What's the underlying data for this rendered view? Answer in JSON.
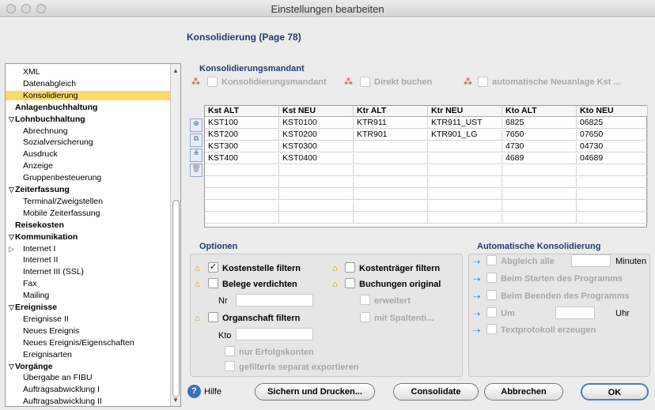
{
  "window": {
    "title": "Einstellungen bearbeiten"
  },
  "page_header": "Konsolidierung (Page 78)",
  "sidebar": {
    "items": [
      {
        "label": "XML",
        "bold": false,
        "tri": ""
      },
      {
        "label": "Datenabgleich",
        "bold": false,
        "tri": ""
      },
      {
        "label": "Konsolidierung",
        "bold": false,
        "tri": "",
        "selected": true
      },
      {
        "label": "Anlagenbuchhaltung",
        "bold": true,
        "tri": ""
      },
      {
        "label": "Lohnbuchhaltung",
        "bold": true,
        "tri": "▽"
      },
      {
        "label": "Abrechnung",
        "bold": false,
        "tri": ""
      },
      {
        "label": "Sozialversicherung",
        "bold": false,
        "tri": ""
      },
      {
        "label": "Ausdruck",
        "bold": false,
        "tri": ""
      },
      {
        "label": "Anzeige",
        "bold": false,
        "tri": ""
      },
      {
        "label": "Gruppenbesteuerung",
        "bold": false,
        "tri": ""
      },
      {
        "label": "Zeiterfassung",
        "bold": true,
        "tri": "▽"
      },
      {
        "label": "Terminal/Zweigstellen",
        "bold": false,
        "tri": ""
      },
      {
        "label": "Mobile Zeiterfassung",
        "bold": false,
        "tri": ""
      },
      {
        "label": "Reisekosten",
        "bold": true,
        "tri": ""
      },
      {
        "label": "Kommunikation",
        "bold": true,
        "tri": "▽"
      },
      {
        "label": "Internet I",
        "bold": false,
        "tri": "▷"
      },
      {
        "label": "Internet II",
        "bold": false,
        "tri": ""
      },
      {
        "label": "Internet III (SSL)",
        "bold": false,
        "tri": ""
      },
      {
        "label": "Fax",
        "bold": false,
        "tri": ""
      },
      {
        "label": "Mailing",
        "bold": false,
        "tri": ""
      },
      {
        "label": "Ereignisse",
        "bold": true,
        "tri": "▽"
      },
      {
        "label": "Ereignisse II",
        "bold": false,
        "tri": ""
      },
      {
        "label": "Neues Ereignis",
        "bold": false,
        "tri": ""
      },
      {
        "label": "Neues Ereignis/Eigenschaften",
        "bold": false,
        "tri": ""
      },
      {
        "label": "Ereignisarten",
        "bold": false,
        "tri": ""
      },
      {
        "label": "Vorgänge",
        "bold": true,
        "tri": "▽"
      },
      {
        "label": "Übergabe an FIBU",
        "bold": false,
        "tri": ""
      },
      {
        "label": "Auftragsabwicklung I",
        "bold": false,
        "tri": ""
      },
      {
        "label": "Auftragsabwicklung II",
        "bold": false,
        "tri": ""
      }
    ]
  },
  "mandant": {
    "heading": "Konsolidierungsmandant",
    "cb1": "Konsolidierungsmandant",
    "cb2": "Direkt buchen",
    "cb3": "automatische Neuanlage Kst ..."
  },
  "grid": {
    "headers": [
      "Kst ALT",
      "Kst NEU",
      "Ktr ALT",
      "Ktr NEU",
      "Kto ALT",
      "Kto NEU"
    ],
    "rows": [
      [
        "KST100",
        "KST0100",
        "KTR911",
        "KTR911_UST",
        "6825",
        "06825"
      ],
      [
        "KST200",
        "KST0200",
        "KTR901",
        "KTR901_LG",
        "7650",
        "07650"
      ],
      [
        "KST300",
        "KST0300",
        "",
        "",
        "4730",
        "04730"
      ],
      [
        "KST400",
        "KST0400",
        "",
        "",
        "4689",
        "04689"
      ]
    ]
  },
  "optionen": {
    "heading": "Optionen",
    "kostenstelle": "Kostenstelle filtern",
    "kostentraeger": "Kostenträger filtern",
    "belege": "Belege verdichten",
    "buchungen": "Buchungen original",
    "nr": "Nr",
    "erweitert": "erweitert",
    "organschaft": "Organschaft filtern",
    "spalten": "mit Spaltenti...",
    "kto": "Kto",
    "nur_erfolg": "nur Erfolgskonten",
    "gefilterte": "gefilterte separat exportieren"
  },
  "auto": {
    "heading": "Automatische Konsolidierung",
    "abgleich": "Abgleich alle",
    "minuten": "Minuten",
    "starten": "Beim Starten des Programms",
    "beenden": "Beim Beenden des Programms",
    "um": "Um",
    "uhr": "Uhr",
    "textprotokoll": "Textprotokoll erzeugen"
  },
  "footer": {
    "help": "Hilfe",
    "save_print": "Sichern und Drucken...",
    "consolidate": "Consolidate",
    "cancel": "Abbrechen",
    "ok": "OK"
  }
}
